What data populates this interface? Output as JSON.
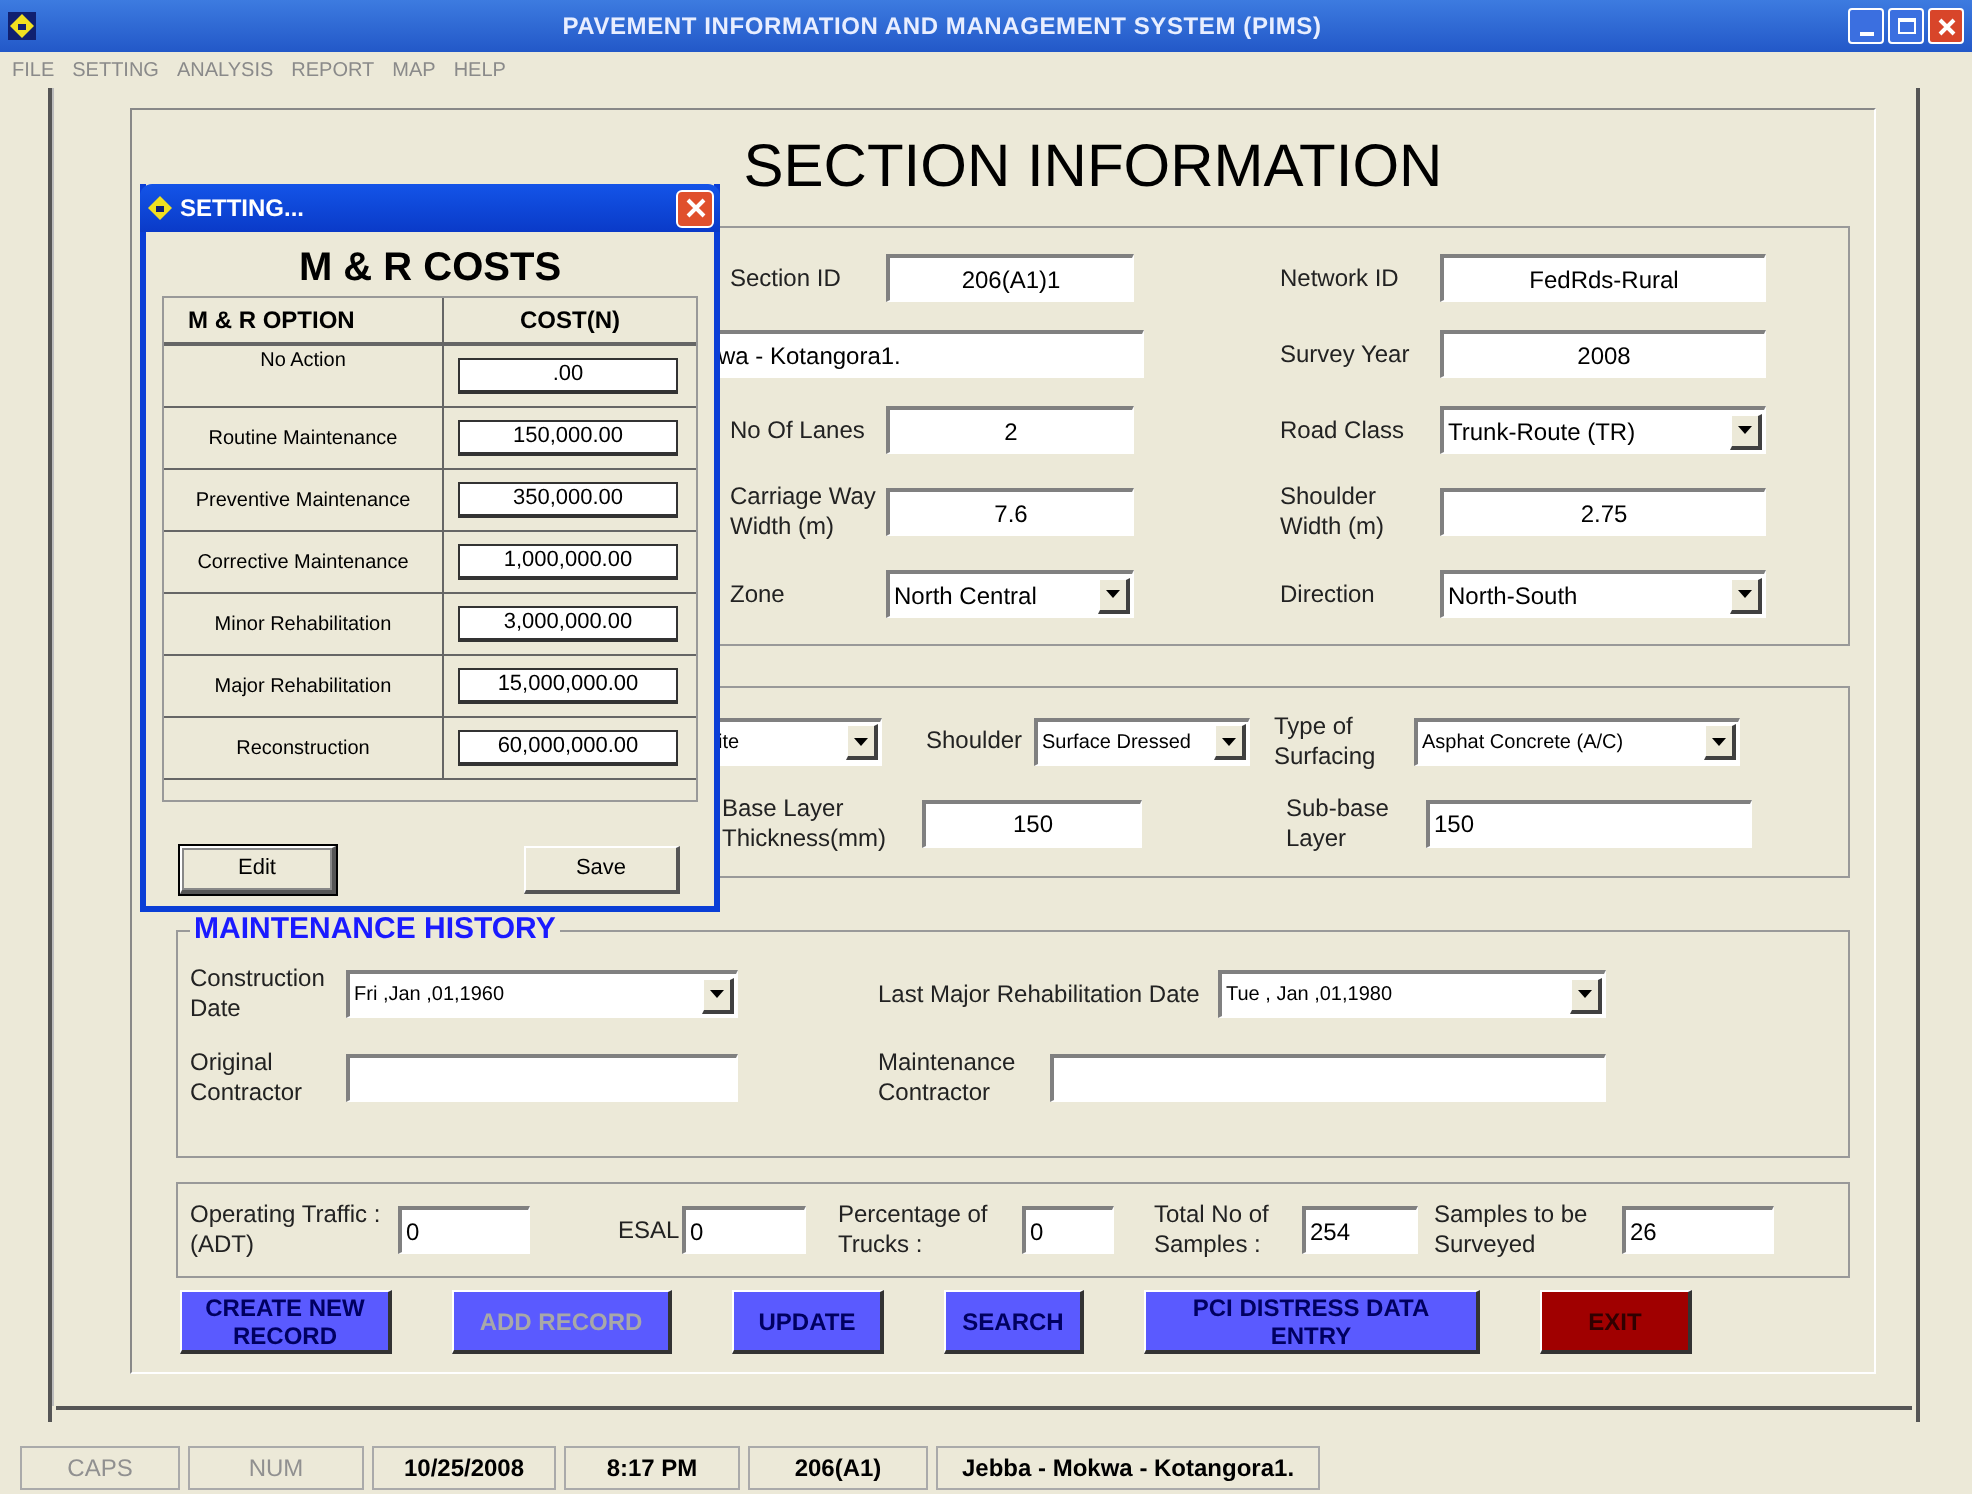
{
  "window": {
    "title": "PAVEMENT INFORMATION AND MANAGEMENT SYSTEM (PIMS)"
  },
  "menu": [
    "FILE",
    "SETTING",
    "ANALYSIS",
    "REPORT",
    "MAP",
    "HELP"
  ],
  "heading": "SECTION INFORMATION",
  "section_info": [
    {
      "left": {
        "label": "Section ID",
        "value": "206(A1)1",
        "kind": "text"
      },
      "right": {
        "label": "Network ID",
        "value": "FedRds-Rural",
        "kind": "text"
      }
    },
    {
      "left": {
        "value": "wa - Kotangora1.",
        "kind": "text"
      },
      "right": {
        "label": "Survey Year",
        "value": "2008",
        "kind": "text"
      }
    },
    {
      "left": {
        "label": "No Of Lanes",
        "value": "2",
        "kind": "text"
      },
      "right": {
        "label": "Road Class",
        "value": "Trunk-Route (TR)",
        "kind": "combo"
      }
    },
    {
      "left": {
        "label": "Carriage Way Width (m)",
        "value": "7.6",
        "kind": "text"
      },
      "right": {
        "label": "Shoulder Width (m)",
        "value": "2.75",
        "kind": "text"
      }
    },
    {
      "left": {
        "label": "Zone",
        "value": "North Central",
        "kind": "combo"
      },
      "right": {
        "label": "Direction",
        "value": "North-South",
        "kind": "combo"
      }
    }
  ],
  "surface": {
    "partial_combo": "ite",
    "shoulder": {
      "label": "Shoulder",
      "value": "Surface Dressed"
    },
    "surfacing": {
      "label": "Type of Surfacing",
      "value": "Asphat Concrete (A/C)"
    },
    "base": {
      "label": "Base Layer Thickness(mm)",
      "value": "150"
    },
    "subbase": {
      "label": "Sub-base Layer",
      "value": "150"
    }
  },
  "maintenance_history": {
    "legend": "MAINTENANCE HISTORY",
    "fields": [
      {
        "label": "Construction Date",
        "value": "Fri  ,Jan ,01,1960",
        "kind": "combo"
      },
      {
        "label": "Last Major Rehabilitation Date",
        "value": "Tue , Jan ,01,1980",
        "kind": "combo"
      },
      {
        "label": "Original Contractor",
        "kind": "text"
      },
      {
        "label": "Maintenance Contractor",
        "kind": "text"
      }
    ]
  },
  "traffic": [
    {
      "label": "Operating Traffic : (ADT)",
      "value": "0"
    },
    {
      "label": "ESAL",
      "value": "0"
    },
    {
      "label": "Percentage of Trucks :",
      "value": "0"
    },
    {
      "label": "Total No of Samples :",
      "value": "254"
    },
    {
      "label": "Samples to be Surveyed",
      "value": "26"
    }
  ],
  "buttons": [
    {
      "label": "CREATE NEW RECORD",
      "kind": "primary",
      "disabled": false
    },
    {
      "label": "ADD RECORD",
      "kind": "primary",
      "disabled": true
    },
    {
      "label": "UPDATE",
      "kind": "primary",
      "disabled": false
    },
    {
      "label": "SEARCH",
      "kind": "primary",
      "disabled": false
    },
    {
      "label": "PCI DISTRESS DATA ENTRY",
      "kind": "primary",
      "disabled": false
    },
    {
      "label": "EXIT",
      "kind": "danger",
      "disabled": false
    }
  ],
  "dialog": {
    "title": "SETTING...",
    "heading": "M & R COSTS",
    "columns": [
      "M & R OPTION",
      "COST(N)"
    ],
    "rows": [
      {
        "option": "No Action",
        "cost": ".00"
      },
      {
        "option": "Routine Maintenance",
        "cost": "150,000.00"
      },
      {
        "option": "Preventive Maintenance",
        "cost": "350,000.00"
      },
      {
        "option": "Corrective Maintenance",
        "cost": "1,000,000.00"
      },
      {
        "option": "Minor Rehabilitation",
        "cost": "3,000,000.00"
      },
      {
        "option": "Major Rehabilitation",
        "cost": "15,000,000.00"
      },
      {
        "option": "Reconstruction",
        "cost": "60,000,000.00"
      }
    ],
    "buttons": [
      {
        "label": "Edit",
        "focused": true
      },
      {
        "label": "Save",
        "focused": false
      }
    ]
  },
  "status_bar": [
    {
      "text": "CAPS",
      "enabled": false
    },
    {
      "text": "NUM",
      "enabled": false
    },
    {
      "text": "10/25/2008",
      "enabled": true
    },
    {
      "text": "8:17 PM",
      "enabled": true
    },
    {
      "text": "206(A1)",
      "enabled": true
    },
    {
      "text": "Jebba - Mokwa - Kotangora1.",
      "enabled": true
    }
  ]
}
